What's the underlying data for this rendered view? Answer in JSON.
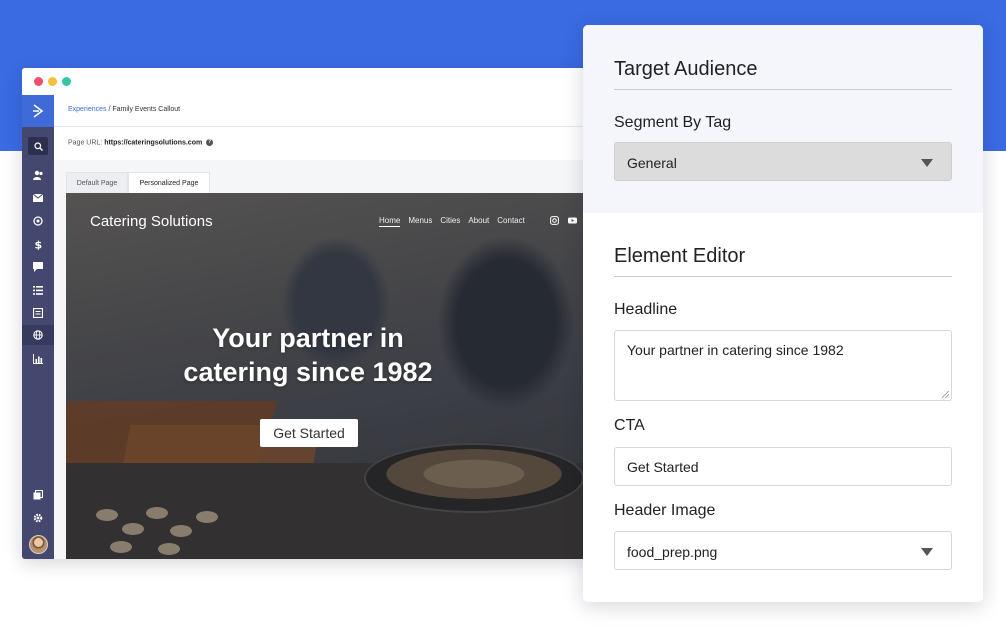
{
  "browser": {
    "breadcrumb": {
      "root": "Experiences",
      "separator": " / ",
      "current": "Family Events Callout"
    },
    "page_url": {
      "label": "Page URL: ",
      "value": "https://cateringsolutions.com"
    },
    "tabs": [
      {
        "label": "Default Page",
        "active": false
      },
      {
        "label": "Personalized Page",
        "active": true
      }
    ],
    "sidebar_icons": [
      "logo-chevron-icon",
      "search-icon",
      "users-icon",
      "mail-icon",
      "target-icon",
      "dollar-icon",
      "chat-icon",
      "list-icon",
      "document-icon",
      "globe-icon",
      "bar-chart-icon",
      "copy-icon",
      "gear-icon"
    ]
  },
  "preview": {
    "site_name": "Catering Solutions",
    "nav": [
      "Home",
      "Menus",
      "Cities",
      "About",
      "Contact"
    ],
    "headline": "Your partner in catering since 1982",
    "cta": "Get Started"
  },
  "panel": {
    "target_audience": {
      "title": "Target Audience",
      "segment_label": "Segment By Tag",
      "segment_value": "General"
    },
    "element_editor": {
      "title": "Element Editor",
      "headline_label": "Headline",
      "headline_value": "Your partner in catering since 1982",
      "cta_label": "CTA",
      "cta_value": "Get Started",
      "image_label": "Header Image",
      "image_value": "food_prep.png"
    }
  },
  "colors": {
    "brand_blue": "#3a6be2",
    "sidebar": "#44486e",
    "panel_top": "#f4f6fc"
  }
}
